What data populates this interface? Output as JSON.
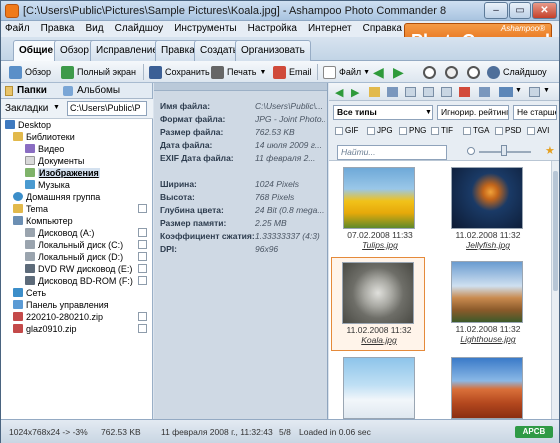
{
  "window": {
    "title": "[C:\\Users\\Public\\Pictures\\Sample Pictures\\Koala.jpg] - Ashampoo Photo Commander 8",
    "controls": [
      "–",
      "▭",
      "✕"
    ]
  },
  "menu": [
    "Файл",
    "Правка",
    "Вид",
    "Слайдшоу",
    "Инструменты",
    "Настройка",
    "Интернет",
    "Справка"
  ],
  "tabs": [
    "Общие",
    "Обзор",
    "Исправление",
    "Правка",
    "Создать",
    "Организовать"
  ],
  "logo": {
    "small": "Ashampoo®",
    "big": "PhotoCommander 8"
  },
  "toolbar": {
    "browse": "Обзор",
    "fullscreen": "Полный экран",
    "save": "Сохранить",
    "print": "Печать",
    "email": "Email",
    "file": "Файл",
    "slideshow": "Слайдшоу"
  },
  "left": {
    "tab_folders": "Папки",
    "tab_albums": "Альбомы",
    "bookmarks_label": "Закладки",
    "path": "C:\\Users\\Public\\P",
    "tree": [
      {
        "label": "Desktop"
      },
      {
        "label": "Библиотеки"
      },
      {
        "label": "Видео"
      },
      {
        "label": "Документы"
      },
      {
        "label": "Изображения"
      },
      {
        "label": "Музыка"
      },
      {
        "label": "Домашняя группа"
      },
      {
        "label": "Tema"
      },
      {
        "label": "Компьютер"
      },
      {
        "label": "Дисковод (A:)"
      },
      {
        "label": "Локальный диск (C:)"
      },
      {
        "label": "Локальный диск (D:)"
      },
      {
        "label": "DVD RW дисковод (E:)"
      },
      {
        "label": "Дисковод BD-ROM (F:)"
      },
      {
        "label": "Сеть"
      },
      {
        "label": "Панель управления"
      },
      {
        "label": "220210-280210.zip"
      },
      {
        "label": "glaz0910.zip"
      }
    ]
  },
  "info": [
    {
      "k": "Имя файла:",
      "v": "C:\\Users\\Public\\..."
    },
    {
      "k": "Формат файла:",
      "v": "JPG - Joint Photo..."
    },
    {
      "k": "Размер файла:",
      "v": "762.53 KB"
    },
    {
      "k": "Дата файла:",
      "v": "14 июля 2009 г..."
    },
    {
      "k": "EXIF Дата файла:",
      "v": "11 февраля 2..."
    },
    {
      "k": "Ширина:",
      "v": "1024 Pixels"
    },
    {
      "k": "Высота:",
      "v": "768 Pixels"
    },
    {
      "k": "Глубина цвета:",
      "v": "24 Bit (0.8 mega..."
    },
    {
      "k": "Размер памяти:",
      "v": "2.25 MB"
    },
    {
      "k": "Коэффициент сжатия:",
      "v": "1.33333337 (4:3)"
    },
    {
      "k": "DPI:",
      "v": "96x96"
    }
  ],
  "filter": {
    "type": "Все типы",
    "ignore": "Игнорир. рейтинг",
    "older": "Не старше",
    "search_placeholder": "Найти...",
    "formats": [
      "GIF",
      "JPG",
      "PNG",
      "TIF",
      "TGA",
      "PSD",
      "AVI"
    ]
  },
  "thumbs": [
    {
      "date": "07.02.2008 11:33",
      "name": "Tulips.jpg"
    },
    {
      "date": "11.02.2008 11:32",
      "name": "Jellyfish.jpg"
    },
    {
      "date": "11.02.2008 11:32",
      "name": "Koala.jpg"
    },
    {
      "date": "11.02.2008 11:32",
      "name": "Lighthouse.jpg"
    },
    {
      "date": "",
      "name": ""
    },
    {
      "date": "",
      "name": ""
    }
  ],
  "status": {
    "dims": "1024x768x24 -> -3%",
    "size": "762.53 KB",
    "date": "11 февраля 2008 г., 11:32:43",
    "count": "5/8",
    "loaded": "Loaded in 0.06 sec",
    "badge": "APCB"
  }
}
